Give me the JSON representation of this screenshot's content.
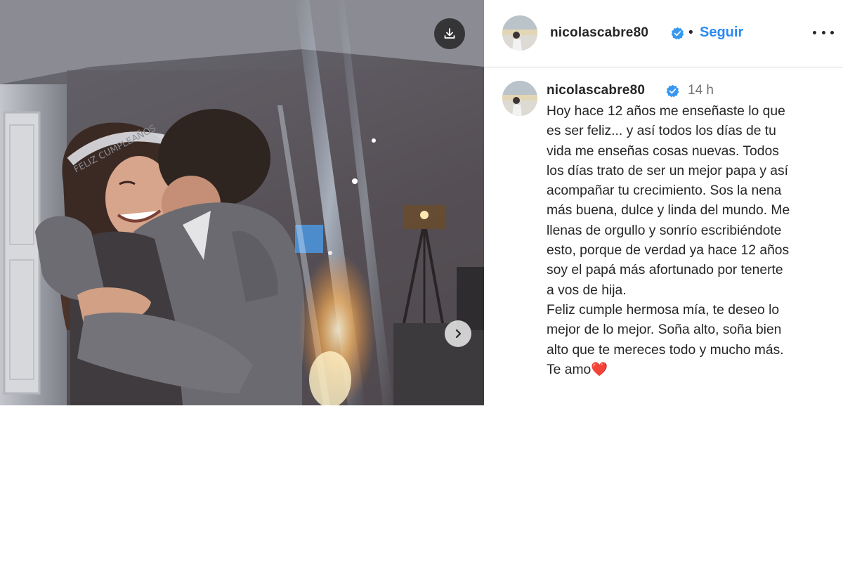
{
  "post": {
    "username": "nicolascabre80",
    "separator": "•",
    "follow_label": "Seguir",
    "verified_icon": "verified-badge-icon",
    "accent_color": "#2b8af2"
  },
  "comment": {
    "username": "nicolascabre80",
    "time": "14 h",
    "lines": [
      "Hoy hace 12 años me enseñaste lo que",
      "es ser feliz... y así todos los días de tu",
      "vida me enseñas cosas nuevas. Todos",
      "los días trato de ser un mejor papa y así",
      "acompañar tu crecimiento. Sos la nena",
      "más buena, dulce y linda del mundo. Me",
      "llenas de orgullo y sonrío escribiéndote",
      "esto, porque de verdad ya hace 12 años",
      "soy el papá más afortunado por tenerte",
      "a vos de hija.",
      "Feliz cumple hermosa mía, te deseo lo",
      "mejor de lo mejor. Soña alto, soña bien",
      "alto que te mereces todo y mucho más."
    ],
    "last_line": "Te amo",
    "last_emoji": "❤️"
  },
  "media": {
    "tiara_text": "FELIZ CUMPLEAÑOS",
    "download_icon": "download-icon",
    "next_icon": "chevron-right-icon"
  }
}
